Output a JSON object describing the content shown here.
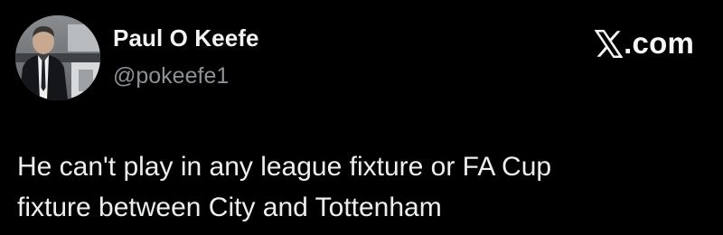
{
  "post": {
    "author": {
      "display_name": "Paul O Keefe",
      "handle": "@pokeefe1",
      "avatar_icon": "profile-photo"
    },
    "source": {
      "logo_icon": "x-logo-icon",
      "label": ".com"
    },
    "text_lines": [
      "He can't play in any league fixture or FA Cup",
      "fixture between City and Tottenham"
    ]
  },
  "colors": {
    "background": "#000000",
    "text_primary": "#eceeef",
    "text_secondary": "#8b9197"
  }
}
